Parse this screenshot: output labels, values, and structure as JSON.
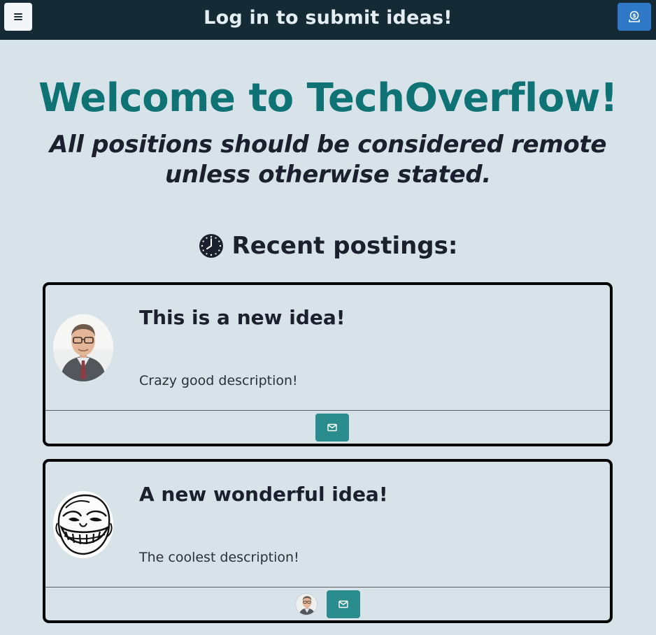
{
  "header": {
    "menu_icon": "hamburger-icon",
    "title": "Log in to submit ideas!",
    "donate_icon": "donate-icon",
    "colors": {
      "bar": "#142a35",
      "donate": "#2f78c8"
    }
  },
  "hero": {
    "welcome": "Welcome to TechOverflow!",
    "subtitle": "All positions should be considered remote unless otherwise stated."
  },
  "recent": {
    "icon": "clock-icon",
    "heading": "Recent postings:"
  },
  "postings": [
    {
      "title": "This is a new idea!",
      "description": "Crazy good description!",
      "avatar": "man-photo-avatar",
      "action_icon": "mail-icon",
      "supporters": []
    },
    {
      "title": "A new wonderful idea!",
      "description": "The coolest description!",
      "avatar": "troll-face-avatar",
      "action_icon": "mail-icon",
      "supporters": [
        "man-photo-avatar"
      ]
    }
  ],
  "colors": {
    "background": "#d7e3e8",
    "accent": "#0f7376",
    "mail_button": "#2a8c8c"
  }
}
